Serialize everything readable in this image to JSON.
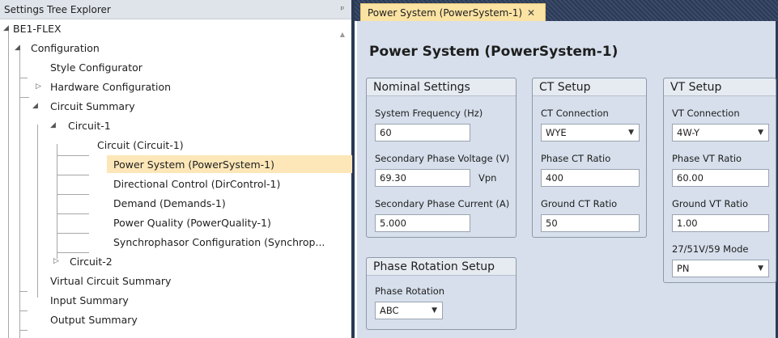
{
  "explorer": {
    "title": "Settings Tree Explorer",
    "pin_icon": "pin-icon",
    "nodes": [
      {
        "label": "BE1-FLEX",
        "toggle": "◢"
      },
      {
        "label": "Configuration",
        "toggle": "◢"
      },
      {
        "label": "Style Configurator",
        "toggle": ""
      },
      {
        "label": "Hardware Configuration",
        "toggle": "▷"
      },
      {
        "label": "Circuit Summary",
        "toggle": "◢"
      },
      {
        "label": "Circuit-1",
        "toggle": "◢"
      },
      {
        "label": "Circuit (Circuit-1)",
        "toggle": ""
      },
      {
        "label": "Power System (PowerSystem-1)",
        "toggle": ""
      },
      {
        "label": "Directional Control (DirControl-1)",
        "toggle": ""
      },
      {
        "label": "Demand (Demands-1)",
        "toggle": ""
      },
      {
        "label": "Power Quality (PowerQuality-1)",
        "toggle": ""
      },
      {
        "label": "Synchrophasor Configuration (Synchrop...",
        "toggle": ""
      },
      {
        "label": "Circuit-2",
        "toggle": "▷"
      },
      {
        "label": "Virtual Circuit Summary",
        "toggle": ""
      },
      {
        "label": "Input Summary",
        "toggle": ""
      },
      {
        "label": "Output Summary",
        "toggle": ""
      }
    ],
    "selected": "Power System (PowerSystem-1)"
  },
  "tab": {
    "label": "Power System (PowerSystem-1)",
    "close": "✕"
  },
  "page": {
    "title": "Power System (PowerSystem-1)"
  },
  "nominal": {
    "header": "Nominal Settings",
    "freq_label": "System Frequency (Hz)",
    "freq_value": "60",
    "sec_voltage_label": "Secondary Phase Voltage (V)",
    "sec_voltage_value": "69.30",
    "sec_voltage_unit": "Vpn",
    "sec_current_label": "Secondary Phase Current (A)",
    "sec_current_value": "5.000"
  },
  "ct": {
    "header": "CT Setup",
    "connection_label": "CT Connection",
    "connection_value": "WYE",
    "phase_ratio_label": "Phase CT Ratio",
    "phase_ratio_value": "400",
    "ground_ratio_label": "Ground CT Ratio",
    "ground_ratio_value": "50"
  },
  "vt": {
    "header": "VT Setup",
    "connection_label": "VT Connection",
    "connection_value": "4W-Y",
    "phase_ratio_label": "Phase VT Ratio",
    "phase_ratio_value": "60.00",
    "ground_ratio_label": "Ground VT Ratio",
    "ground_ratio_value": "1.00",
    "mode_label": "27/51V/59 Mode",
    "mode_value": "PN"
  },
  "rotation": {
    "header": "Phase Rotation Setup",
    "label": "Phase Rotation",
    "value": "ABC"
  },
  "icons": {
    "dropdown": "chevron-down-icon",
    "scroll": "scroll-up-icon"
  }
}
